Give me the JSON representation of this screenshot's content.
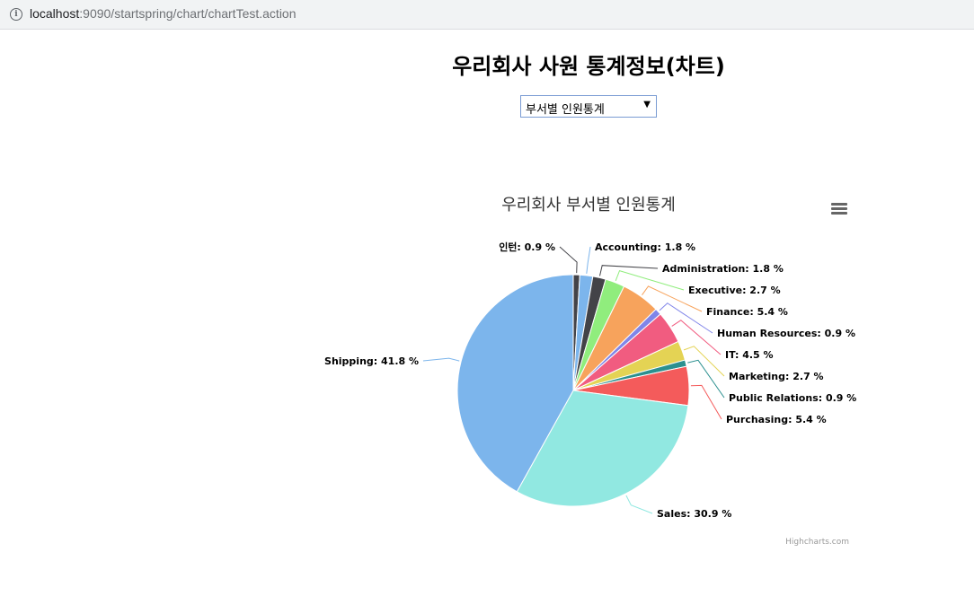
{
  "browser": {
    "url_host": "localhost",
    "url_rest": ":9090/startspring/chart/chartTest.action"
  },
  "page": {
    "title": "우리회사 사원 통계정보(차트)",
    "select_value": "부서별 인원통계"
  },
  "chart_data": {
    "type": "pie",
    "title": "우리회사 부서별 인원통계",
    "credits": "Highcharts.com",
    "unit": "%",
    "slices": [
      {
        "name": "인턴",
        "value": 0.9,
        "color": "#434348"
      },
      {
        "name": "Accounting",
        "value": 1.8,
        "color": "#7cb5ec"
      },
      {
        "name": "Administration",
        "value": 1.8,
        "color": "#434348"
      },
      {
        "name": "Executive",
        "value": 2.7,
        "color": "#90ed7d"
      },
      {
        "name": "Finance",
        "value": 5.4,
        "color": "#f7a35c"
      },
      {
        "name": "Human Resources",
        "value": 0.9,
        "color": "#8085e9"
      },
      {
        "name": "IT",
        "value": 4.5,
        "color": "#f15c80"
      },
      {
        "name": "Marketing",
        "value": 2.7,
        "color": "#e4d354"
      },
      {
        "name": "Public Relations",
        "value": 0.9,
        "color": "#2b908f"
      },
      {
        "name": "Purchasing",
        "value": 5.4,
        "color": "#f45b5b"
      },
      {
        "name": "Sales",
        "value": 30.9,
        "color": "#91e8e1"
      },
      {
        "name": "Shipping",
        "value": 41.8,
        "color": "#7cb5ec"
      }
    ]
  }
}
